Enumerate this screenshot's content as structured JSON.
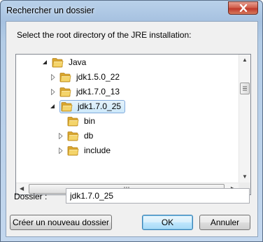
{
  "window": {
    "title": "Rechercher un dossier"
  },
  "prompt": "Select the root directory of the JRE installation:",
  "tree": {
    "items": [
      {
        "label": "Java",
        "expander": "expanded-arrow-icon",
        "level": 0,
        "selected": false
      },
      {
        "label": "jdk1.5.0_22",
        "expander": "collapsed-arrow-icon",
        "level": 1,
        "selected": false
      },
      {
        "label": "jdk1.7.0_13",
        "expander": "collapsed-arrow-icon",
        "level": 1,
        "selected": false
      },
      {
        "label": "jdk1.7.0_25",
        "expander": "expanded-arrow-icon",
        "level": 1,
        "selected": true
      },
      {
        "label": "bin",
        "expander": "none",
        "level": 2,
        "selected": false
      },
      {
        "label": "db",
        "expander": "collapsed-arrow-icon",
        "level": 2,
        "selected": false
      },
      {
        "label": "include",
        "expander": "collapsed-arrow-icon",
        "level": 2,
        "selected": false
      }
    ]
  },
  "folder_field": {
    "label": "Dossier :",
    "value": "jdk1.7.0_25"
  },
  "buttons": {
    "new_folder": "Créer un nouveau dossier",
    "ok": "OK",
    "cancel": "Annuler"
  },
  "colors": {
    "title_gradient": "#b9d1ea",
    "close_red": "#c0392b",
    "selection_border": "#84acdd",
    "default_button_border": "#3c7fb1",
    "folder_yellow": "#e8c547"
  },
  "icons": {
    "close": "close-icon",
    "folder": "folder-icon"
  }
}
